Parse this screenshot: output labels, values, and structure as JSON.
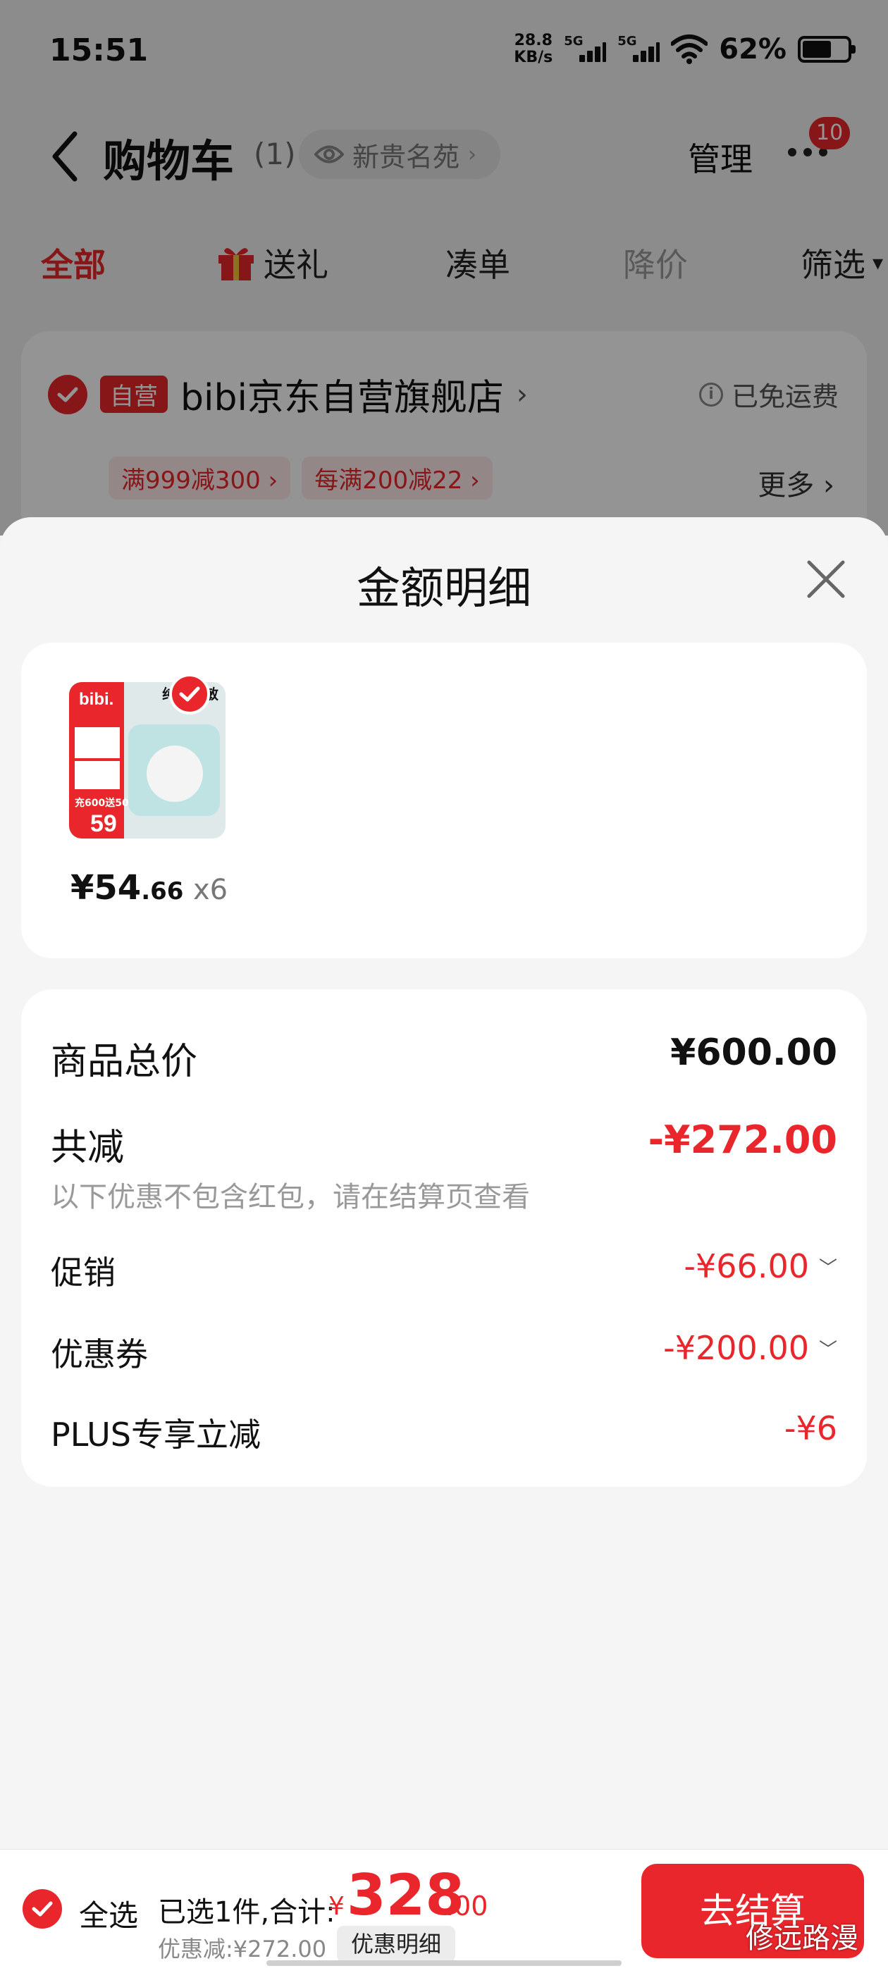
{
  "status_bar": {
    "time": "15:51",
    "net_speed_value": "28.8",
    "net_speed_unit": "KB/s",
    "sim1_label": "5G",
    "sim2_label": "5G",
    "battery_percent": "62%",
    "battery_level": 0.62
  },
  "nav": {
    "title": "购物车",
    "count": "(1)",
    "address": "新贵名苑",
    "manage": "管理",
    "badge": "10"
  },
  "tabs": [
    {
      "label": "全部",
      "state": "active"
    },
    {
      "label": "送礼",
      "state": "normal"
    },
    {
      "label": "凑单",
      "state": "normal"
    },
    {
      "label": "降价",
      "state": "muted"
    },
    {
      "label": "筛选",
      "state": "normal"
    }
  ],
  "shop": {
    "tag": "自营",
    "name": "bibi京东自营旗舰店",
    "free_shipping": "已免运费",
    "promos": [
      "满999减300",
      "每满200减22"
    ],
    "more": "更多"
  },
  "sheet": {
    "title": "金额明细",
    "product": {
      "price_symbol": "¥",
      "price_int": "54",
      "price_dec": ".66",
      "quantity": "x6",
      "image_brand": "bibi.",
      "image_headline": "纯净护敏",
      "image_offer": "充600送50",
      "image_price": "59"
    },
    "summary": {
      "total_label": "商品总价",
      "total_value": "¥600.00",
      "reduce_label": "共减",
      "reduce_value": "-¥272.00",
      "reduce_note": "以下优惠不包含红包，请在结算页查看",
      "items": [
        {
          "label": "促销",
          "value": "-¥66.00",
          "expandable": true
        },
        {
          "label": "优惠券",
          "value": "-¥200.00",
          "expandable": true
        },
        {
          "label": "PLUS专享立减",
          "value": "-¥6",
          "expandable": false
        }
      ]
    }
  },
  "footer": {
    "select_all": "全选",
    "selected_text": "已选1件,合计:",
    "currency": "¥",
    "total_int": "328",
    "total_dec": ".00",
    "discount_text": "优惠减:¥272.00",
    "detail_button": "优惠明细",
    "checkout_button": "去结算"
  },
  "watermark": "修远路漫",
  "colors": {
    "accent": "#e8262c",
    "background": "#f5f5f5",
    "card": "#ffffff"
  }
}
